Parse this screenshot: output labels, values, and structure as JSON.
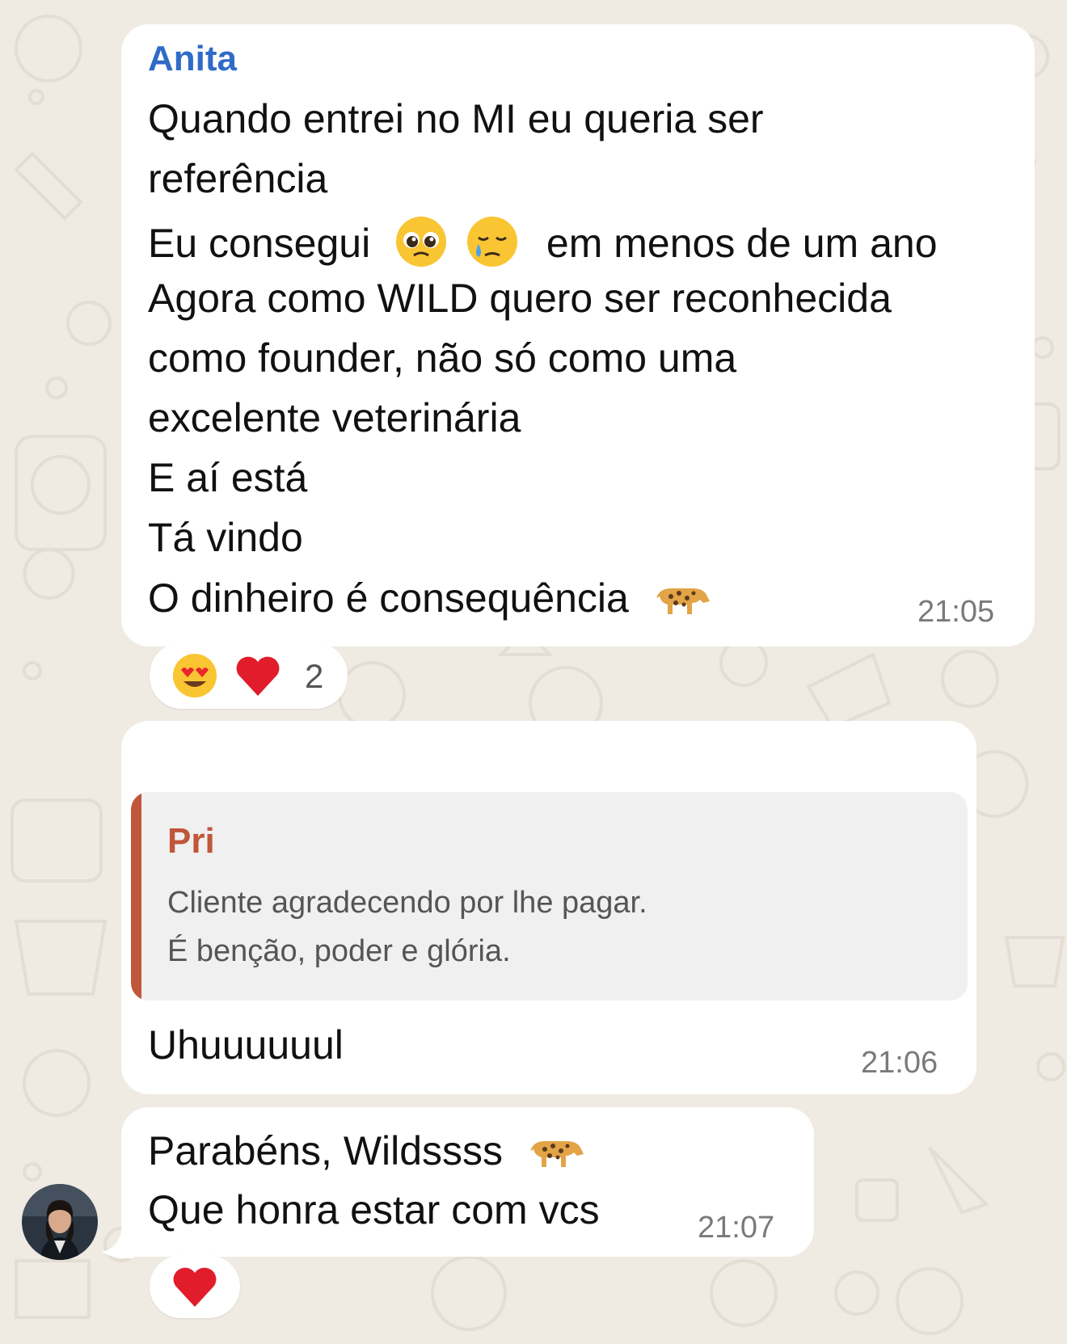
{
  "chat": {
    "messages": [
      {
        "sender": "Anita",
        "lines": [
          "Quando entrei no MI eu queria ser",
          "referência",
          "Eu consegui",
          "em menos de um ano",
          "Agora como WILD quero ser reconhecida",
          "como founder, não só como uma",
          "excelente veterinária",
          "E aí está",
          "Tá vindo",
          "O dinheiro é consequência"
        ],
        "inline_emojis": [
          "pleading-face",
          "crying-face",
          "leopard"
        ],
        "time": "21:05",
        "reactions": {
          "emojis": [
            "heart-eyes",
            "red-heart"
          ],
          "count": "2"
        }
      },
      {
        "quote": {
          "author": "Pri",
          "lines": [
            "Cliente agradecendo por lhe pagar.",
            "É benção, poder e glória."
          ]
        },
        "text": "Uhuuuuuul",
        "time": "21:06"
      },
      {
        "lines": [
          "Parabéns, Wildssss",
          "Que honra estar com vcs"
        ],
        "inline_emojis": [
          "leopard"
        ],
        "time": "21:07",
        "reactions": {
          "emojis": [
            "red-heart"
          ]
        }
      }
    ]
  },
  "colors": {
    "background": "#efeae2",
    "bubble": "#ffffff",
    "sender_name": "#2f6bc7",
    "quote_accent": "#c0573a",
    "timestamp": "#7a7a7a"
  }
}
